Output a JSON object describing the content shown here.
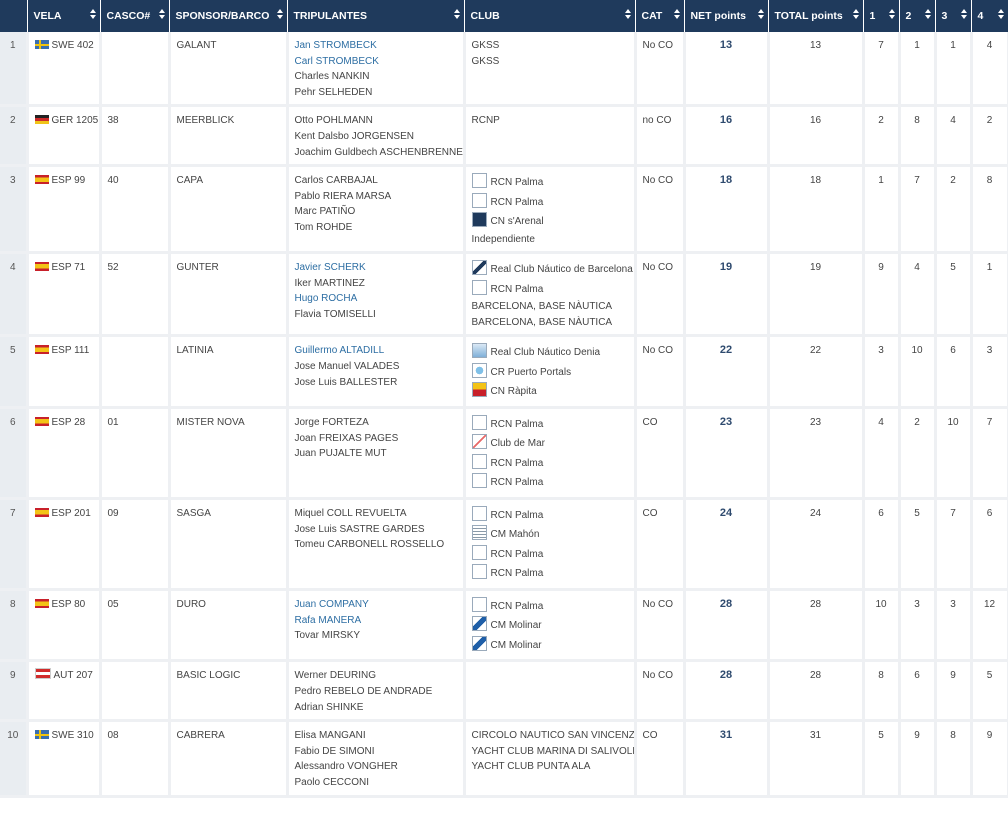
{
  "headers": [
    {
      "key": "pos",
      "label": ""
    },
    {
      "key": "vela",
      "label": "VELA"
    },
    {
      "key": "casco",
      "label": "CASCO#"
    },
    {
      "key": "sponsor",
      "label": "SPONSOR/BARCO"
    },
    {
      "key": "crew",
      "label": "TRIPULANTES"
    },
    {
      "key": "club",
      "label": "CLUB"
    },
    {
      "key": "cat",
      "label": "CAT"
    },
    {
      "key": "net",
      "label": "NET points"
    },
    {
      "key": "total",
      "label": "TOTAL points"
    },
    {
      "key": "r1",
      "label": "1"
    },
    {
      "key": "r2",
      "label": "2"
    },
    {
      "key": "r3",
      "label": "3"
    },
    {
      "key": "r4",
      "label": "4"
    }
  ],
  "rows": [
    {
      "pos": "1",
      "flag": "swe",
      "vela": "SWE 402",
      "casco": "",
      "sponsor": "GALANT",
      "crew": [
        {
          "name": "Jan STROMBECK",
          "link": true
        },
        {
          "name": "Carl STROMBECK",
          "link": true
        },
        {
          "name": "Charles NANKIN",
          "link": false
        },
        {
          "name": "Pehr SELHEDEN",
          "link": false
        }
      ],
      "clubs": [
        {
          "name": "GKSS",
          "logo": ""
        },
        {
          "name": "GKSS",
          "logo": ""
        }
      ],
      "cat": "No CO",
      "net": "13",
      "total": "13",
      "races": [
        "7",
        "1",
        "1",
        "4"
      ]
    },
    {
      "pos": "2",
      "flag": "ger",
      "vela": "GER 1205",
      "casco": "38",
      "sponsor": "MEERBLICK",
      "crew": [
        {
          "name": "Otto POHLMANN",
          "link": false
        },
        {
          "name": "Kent Dalsbo JORGENSEN",
          "link": false
        },
        {
          "name": "Joachim Guldbech ASCHENBRENNER",
          "link": false
        }
      ],
      "clubs": [
        {
          "name": "RCNP",
          "logo": ""
        }
      ],
      "cat": "no CO",
      "net": "16",
      "total": "16",
      "races": [
        "2",
        "8",
        "4",
        "2"
      ]
    },
    {
      "pos": "3",
      "flag": "esp",
      "vela": "ESP 99",
      "casco": "40",
      "sponsor": "CAPA",
      "crew": [
        {
          "name": "Carlos CARBAJAL",
          "link": false
        },
        {
          "name": "Pablo RIERA MARSA",
          "link": false
        },
        {
          "name": "Marc PATIÑO",
          "link": false
        },
        {
          "name": "Tom ROHDE",
          "link": false
        }
      ],
      "clubs": [
        {
          "name": "RCN Palma",
          "logo": "rcnp"
        },
        {
          "name": "RCN Palma",
          "logo": "rcnp"
        },
        {
          "name": "CN s'Arenal",
          "logo": "cn"
        },
        {
          "name": "Independiente",
          "logo": ""
        }
      ],
      "cat": "No CO",
      "net": "18",
      "total": "18",
      "races": [
        "1",
        "7",
        "2",
        "8"
      ]
    },
    {
      "pos": "4",
      "flag": "esp",
      "vela": "ESP 71",
      "casco": "52",
      "sponsor": "GUNTER",
      "crew": [
        {
          "name": "Javier SCHERK",
          "link": true
        },
        {
          "name": "Iker MARTINEZ",
          "link": false
        },
        {
          "name": "Hugo ROCHA",
          "link": true
        },
        {
          "name": "Flavia TOMISELLI",
          "link": false
        }
      ],
      "clubs": [
        {
          "name": "Real Club Náutico de Barcelona",
          "logo": "rcnb"
        },
        {
          "name": "RCN Palma",
          "logo": "rcnp"
        },
        {
          "name": "BARCELONA, BASE NÀUTICA",
          "logo": ""
        },
        {
          "name": "BARCELONA, BASE NÀUTICA",
          "logo": ""
        }
      ],
      "cat": "No CO",
      "net": "19",
      "total": "19",
      "races": [
        "9",
        "4",
        "5",
        "1"
      ]
    },
    {
      "pos": "5",
      "flag": "esp",
      "vela": "ESP 111",
      "casco": "",
      "sponsor": "LATINIA",
      "crew": [
        {
          "name": "Guillermo ALTADILL",
          "link": true
        },
        {
          "name": "Jose Manuel VALADES",
          "link": false
        },
        {
          "name": "Jose Luis BALLESTER",
          "link": false
        }
      ],
      "clubs": [
        {
          "name": "Real Club Náutico Denia",
          "logo": "cnd"
        },
        {
          "name": "CR Puerto Portals",
          "logo": "crpp"
        },
        {
          "name": "CN Ràpita",
          "logo": "cnr"
        }
      ],
      "cat": "No CO",
      "net": "22",
      "total": "22",
      "races": [
        "3",
        "10",
        "6",
        "3"
      ]
    },
    {
      "pos": "6",
      "flag": "esp",
      "vela": "ESP 28",
      "casco": "01",
      "sponsor": "MISTER NOVA",
      "crew": [
        {
          "name": "Jorge FORTEZA",
          "link": false
        },
        {
          "name": "Joan FREIXAS PAGES",
          "link": false
        },
        {
          "name": "Juan PUJALTE MUT",
          "link": false
        }
      ],
      "clubs": [
        {
          "name": "RCN Palma",
          "logo": "rcnp"
        },
        {
          "name": "Club de Mar",
          "logo": "cdm"
        },
        {
          "name": "RCN Palma",
          "logo": "rcnp"
        },
        {
          "name": "RCN Palma",
          "logo": "rcnp"
        }
      ],
      "cat": "CO",
      "net": "23",
      "total": "23",
      "races": [
        "4",
        "2",
        "10",
        "7"
      ]
    },
    {
      "pos": "7",
      "flag": "esp",
      "vela": "ESP 201",
      "casco": "09",
      "sponsor": "SASGA",
      "crew": [
        {
          "name": "Miquel COLL REVUELTA",
          "link": false
        },
        {
          "name": "Jose Luis SASTRE GARDES",
          "link": false
        },
        {
          "name": "Tomeu CARBONELL ROSSELLO",
          "link": false
        }
      ],
      "clubs": [
        {
          "name": "RCN Palma",
          "logo": "rcnp"
        },
        {
          "name": "CM Mahón",
          "logo": "cmm"
        },
        {
          "name": "RCN Palma",
          "logo": "rcnp"
        },
        {
          "name": "RCN Palma",
          "logo": "rcnp"
        }
      ],
      "cat": "CO",
      "net": "24",
      "total": "24",
      "races": [
        "6",
        "5",
        "7",
        "6"
      ]
    },
    {
      "pos": "8",
      "flag": "esp",
      "vela": "ESP 80",
      "casco": "05",
      "sponsor": "DURO",
      "crew": [
        {
          "name": "Juan COMPANY",
          "link": true
        },
        {
          "name": "Rafa MANERA",
          "link": true
        },
        {
          "name": "Tovar MIRSKY",
          "link": false
        }
      ],
      "clubs": [
        {
          "name": "RCN Palma",
          "logo": "rcnp"
        },
        {
          "name": "CM Molinar",
          "logo": "cmol"
        },
        {
          "name": "CM Molinar",
          "logo": "cmol"
        }
      ],
      "cat": "No CO",
      "net": "28",
      "total": "28",
      "races": [
        "10",
        "3",
        "3",
        "12"
      ]
    },
    {
      "pos": "9",
      "flag": "aut",
      "vela": "AUT 207",
      "casco": "",
      "sponsor": "BASIC LOGIC",
      "crew": [
        {
          "name": "Werner DEURING",
          "link": false
        },
        {
          "name": "Pedro REBELO DE ANDRADE",
          "link": false
        },
        {
          "name": "Adrian SHINKE",
          "link": false
        }
      ],
      "clubs": [],
      "cat": "No CO",
      "net": "28",
      "total": "28",
      "races": [
        "8",
        "6",
        "9",
        "5"
      ]
    },
    {
      "pos": "10",
      "flag": "swe",
      "vela": "SWE 310",
      "casco": "08",
      "sponsor": "CABRERA",
      "crew": [
        {
          "name": "Elisa MANGANI",
          "link": false
        },
        {
          "name": "Fabio DE SIMONI",
          "link": false
        },
        {
          "name": "Alessandro VONGHER",
          "link": false
        },
        {
          "name": "Paolo CECCONI",
          "link": false
        }
      ],
      "clubs": [
        {
          "name": "CIRCOLO NAUTICO SAN VINCENZO",
          "logo": ""
        },
        {
          "name": "YACHT CLUB MARINA DI SALIVOLI",
          "logo": ""
        },
        {
          "name": "YACHT CLUB PUNTA ALA",
          "logo": ""
        }
      ],
      "cat": "CO",
      "net": "31",
      "total": "31",
      "races": [
        "5",
        "9",
        "8",
        "9"
      ]
    }
  ]
}
